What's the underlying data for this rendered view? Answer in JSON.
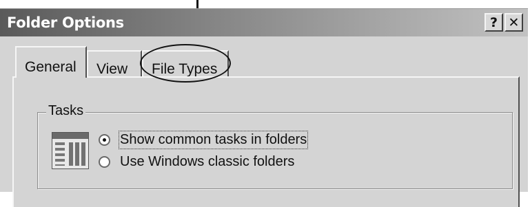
{
  "window": {
    "title": "Folder Options",
    "help_label": "?",
    "close_label": "✕"
  },
  "tabs": [
    {
      "label": "General",
      "active": true
    },
    {
      "label": "View",
      "active": false
    },
    {
      "label": "File Types",
      "active": false
    }
  ],
  "tasks_group": {
    "legend": "Tasks",
    "icon": "folder-tasks-icon",
    "options": [
      {
        "label": "Show common tasks in folders",
        "selected": true
      },
      {
        "label": "Use Windows classic folders",
        "selected": false
      }
    ]
  }
}
